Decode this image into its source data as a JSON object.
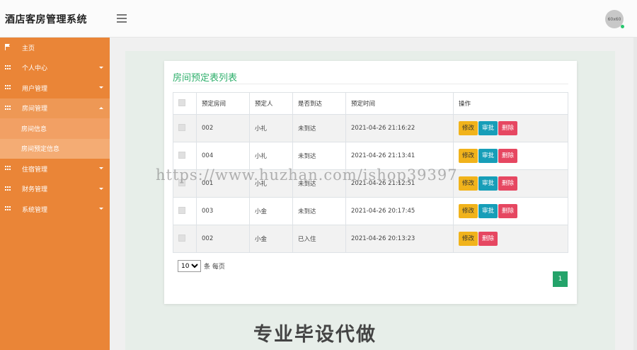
{
  "header": {
    "brand": "酒店客房管理系统",
    "avatar_text": "60x60"
  },
  "sidebar": {
    "items": [
      {
        "label": "主页",
        "icon": "flag-icon"
      },
      {
        "label": "个人中心",
        "icon": "grid-icon"
      },
      {
        "label": "用户管理",
        "icon": "grid-icon"
      },
      {
        "label": "房间管理",
        "icon": "grid-icon"
      },
      {
        "label": "住宿管理",
        "icon": "grid-icon"
      },
      {
        "label": "财务管理",
        "icon": "grid-icon"
      },
      {
        "label": "系统管理",
        "icon": "grid-icon"
      }
    ],
    "sub_items": [
      "房间信息",
      "房间预定信息"
    ]
  },
  "panel": {
    "title": "房间预定表列表",
    "columns": [
      "预定房间",
      "预定人",
      "是否到达",
      "预定时间",
      "操作"
    ],
    "rows": [
      {
        "room": "002",
        "person": "小礼",
        "arrived": "未到达",
        "time": "2021-04-26 21:16:22"
      },
      {
        "room": "004",
        "person": "小礼",
        "arrived": "未到达",
        "time": "2021-04-26 21:13:41"
      },
      {
        "room": "001",
        "person": "小礼",
        "arrived": "未到达",
        "time": "2021-04-26 21:12:51"
      },
      {
        "room": "003",
        "person": "小金",
        "arrived": "未到达",
        "time": "2021-04-26 20:17:45"
      },
      {
        "room": "002",
        "person": "小金",
        "arrived": "已入住",
        "time": "2021-04-26 20:13:23"
      }
    ],
    "btn_edit": "修改",
    "btn_approve": "审批",
    "btn_delete": "删除",
    "page_size": "10",
    "page_size_suffix": "条 每页",
    "current_page": "1"
  },
  "overlay": {
    "watermark": "https://www.huzhan.com/ishop39397",
    "promo": "专业毕设代做"
  },
  "colors": {
    "sidebar": "#ea8537",
    "title": "#2eaf6b",
    "edit": "#f1b31b",
    "approve": "#179eb8",
    "delete": "#e64761",
    "pagination": "#24a36a"
  }
}
